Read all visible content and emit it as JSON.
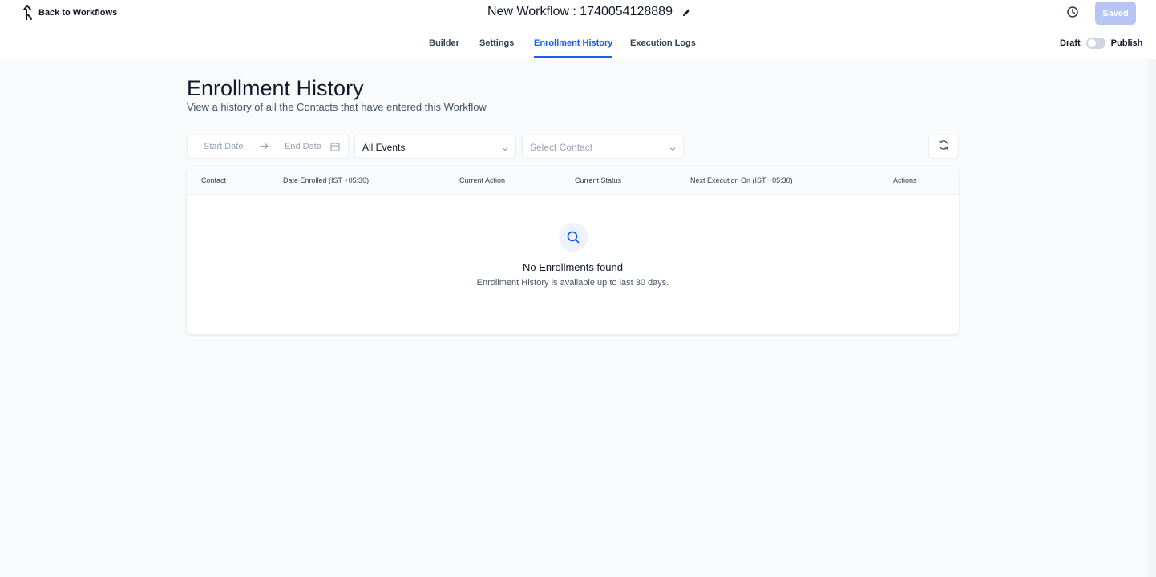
{
  "header": {
    "back_label": "Back to Workflows",
    "workflow_title": "New Workflow : 1740054128889",
    "saved_label": "Saved",
    "draft_label": "Draft",
    "publish_label": "Publish",
    "published": false
  },
  "tabs": [
    {
      "label": "Builder",
      "active": false
    },
    {
      "label": "Settings",
      "active": false
    },
    {
      "label": "Enrollment History",
      "active": true
    },
    {
      "label": "Execution Logs",
      "active": false
    }
  ],
  "page": {
    "title": "Enrollment History",
    "subtitle": "View a history of all the Contacts that have entered this Workflow"
  },
  "filters": {
    "start_date_placeholder": "Start Date",
    "end_date_placeholder": "End Date",
    "events_value": "All Events",
    "contact_placeholder": "Select Contact"
  },
  "table": {
    "columns": [
      "Contact",
      "Date Enrolled (IST +05:30)",
      "Current Action",
      "Current Status",
      "Next Execution On (IST +05:30)",
      "Actions"
    ],
    "rows": [],
    "empty_title": "No Enrollments found",
    "empty_subtitle": "Enrollment History is available up to last 30 days."
  },
  "colors": {
    "accent": "#155eef",
    "saved_button": "#b7c5f3",
    "background": "#f9fafb"
  }
}
